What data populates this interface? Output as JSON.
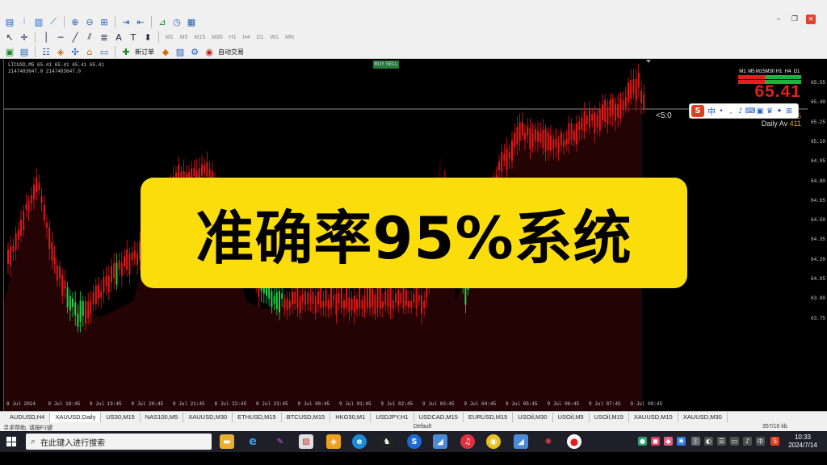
{
  "toolbar": {
    "timeframes": [
      "M1",
      "M5",
      "M15",
      "M30",
      "H1",
      "H4",
      "D1",
      "W1",
      "MN"
    ],
    "new_order_label": "新订单",
    "auto_trade_label": "自动交易"
  },
  "chart": {
    "symbol_line_1": "LTCUSD,M5  65.41  65.41  65.41  65.41",
    "symbol_line_2": "2147483647.0    2147483647.0",
    "mini_button": "BUY SELL",
    "ratio_label": "<5:0",
    "price_labels": [
      "65.55",
      "65.40",
      "65.25",
      "65.10",
      "64.95",
      "64.80",
      "64.65",
      "64.50",
      "64.35",
      "64.20",
      "64.05",
      "63.90",
      "63.75"
    ],
    "time_labels": [
      "8 Jul 2024",
      "8 Jul 18:45",
      "8 Jul 19:45",
      "8 Jul 20:45",
      "8 Jul 21:45",
      "8 Jul 22:45",
      "8 Jul 23:45",
      "9 Jul 00:45",
      "9 Jul 01:45",
      "9 Jul 02:45",
      "9 Jul 03:45",
      "9 Jul 04:45",
      "9 Jul 05:45",
      "9 Jul 06:45",
      "9 Jul 07:45",
      "9 Jul 08:45"
    ],
    "current_price_line": "65.41",
    "colors": {
      "bull": "#1fd34a",
      "bear": "#e01818",
      "shade": "#3a0505"
    }
  },
  "indicator": {
    "timeframes": [
      "M1",
      "M5",
      "M15",
      "M30",
      "H1",
      "H4",
      "D1"
    ],
    "big_price": "65.41",
    "hi_low_label": "Hi to Low",
    "hi_low_value": "145",
    "daily_av_label": "Daily Av",
    "daily_av_value": "411"
  },
  "ime": {
    "logo": "S",
    "mode": "中"
  },
  "banner": {
    "text": "准确率95%系统"
  },
  "tabs": [
    "AUDUSD,H4",
    "XAUUSD,Daily",
    "US30,M15",
    "NAS100,M5",
    "XAUUSD,M30",
    "ETHUSD,M15",
    "BTCUSD,M15",
    "HKG50,M1",
    "USDJPY,H1",
    "USDCAD,M15",
    "EURUSD,M15",
    "USOil,M30",
    "USOil,M5",
    "USOil,M15",
    "XAUUSD,M15",
    "XAUUSD,M30"
  ],
  "statusbar": {
    "left": "寻求帮助, 请按F1键",
    "middle": "Default",
    "right": "357/10 kb"
  },
  "taskbar": {
    "search_placeholder": "在此键入进行搜索",
    "time": "10:33",
    "date": "2024/7/14"
  }
}
